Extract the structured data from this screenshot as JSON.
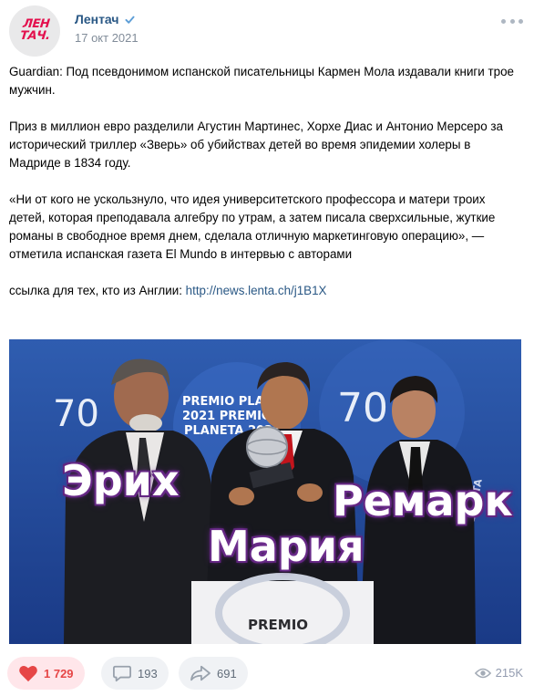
{
  "post": {
    "author": "Лентач",
    "avatar_text_line1": "ЛЕН",
    "avatar_text_line2": "ТАЧ.",
    "date": "17 окт 2021",
    "paragraphs": [
      "Guardian: Под псевдонимом испанской писательницы Кармен Мола издавали книги трое мужчин.",
      "Приз в миллион евро разделили Агустин Мартинес, Хорхе Диас и Антонио Мерсеро за исторический триллер «Зверь» об убийствах детей во время эпидемии холеры в Мадриде в 1834 году.",
      "«Ни от кого не ускользнуло, что идея университетского профессора и матери троих детей, которая преподавала алгебру по утрам, а затем писала сверхсильные, жуткие романы в свободное время днем, сделала отличную маркетинговую операцию», — отметила испанская газета El Mundo в интервью с авторами"
    ],
    "link_prefix": "ссылка для тех, кто из Англии: ",
    "link_text": "http://news.lenta.ch/j1B1X"
  },
  "photo": {
    "overlay_words": [
      "Эрих",
      "Мария",
      "Ремарк"
    ],
    "backdrop_texts": [
      "70",
      "70",
      "PREMIO PLANETA",
      "2021 PREMIO",
      "PLANETA 2021",
      "PREMIO PLANETA",
      "PREMIO"
    ]
  },
  "footer": {
    "likes": "1 729",
    "comments": "193",
    "shares": "691",
    "views": "215K"
  },
  "colors": {
    "link": "#2a5885",
    "like_bg": "#ffe6ea",
    "like_red": "#e64646",
    "muted": "#818c99"
  },
  "icons": [
    "verified-icon",
    "more-icon",
    "heart-icon",
    "comment-icon",
    "share-icon",
    "eye-icon"
  ]
}
